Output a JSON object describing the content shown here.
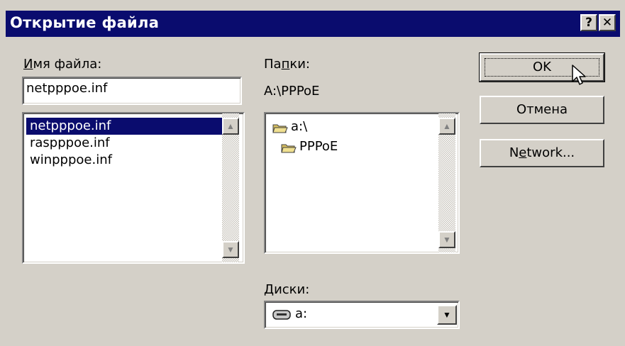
{
  "window": {
    "title": "Открытие файла",
    "help_glyph": "?",
    "close_glyph": "✕"
  },
  "filename": {
    "label_accel": "И",
    "label_rest": "мя файла:",
    "value": "netpppoe.inf",
    "files": [
      "netpppoe.inf",
      "raspppoe.inf",
      "winpppoe.inf"
    ]
  },
  "folders": {
    "label_pre": "Па",
    "label_accel": "п",
    "label_post": "ки:",
    "current_path": "A:\\PPPoE",
    "tree": [
      "a:\\",
      "PPPoE"
    ]
  },
  "drives": {
    "label_accel": "Д",
    "label_rest": "иски:",
    "selected": "a:"
  },
  "buttons": {
    "ok": "OK",
    "cancel": "Отмена",
    "network_pre": "N",
    "network_accel": "e",
    "network_post": "twork..."
  },
  "scroll_glyphs": {
    "up": "▲",
    "down": "▼"
  },
  "icons": [
    "help-icon",
    "close-icon",
    "folder-open-icon",
    "drive-icon",
    "chevron-down-icon",
    "cursor-icon"
  ]
}
